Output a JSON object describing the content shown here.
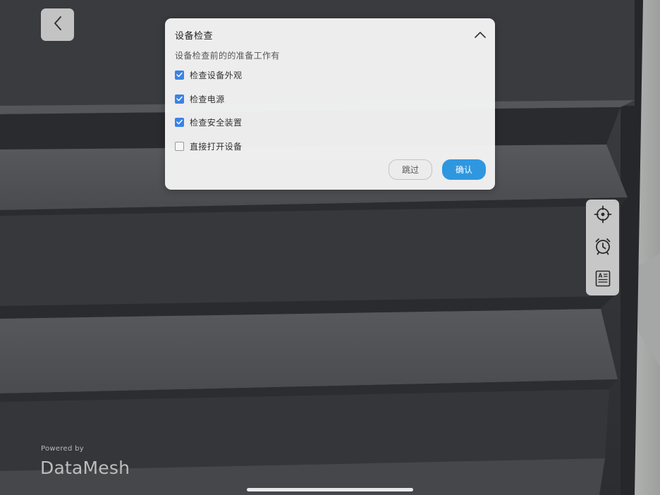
{
  "dialog": {
    "title": "设备检查",
    "description": "设备检查前的的准备工作有",
    "options": [
      {
        "label": "检查设备外观",
        "checked": true
      },
      {
        "label": "检查电源",
        "checked": true
      },
      {
        "label": "检查安全装置",
        "checked": true
      },
      {
        "label": "直接打开设备",
        "checked": false
      }
    ],
    "skip_label": "跳过",
    "confirm_label": "确认"
  },
  "toolbar": {
    "tools": [
      {
        "icon": "crosshair-icon"
      },
      {
        "icon": "alarm-clock-icon"
      },
      {
        "icon": "document-text-icon"
      }
    ]
  },
  "branding": {
    "powered_by": "Powered by",
    "brand_name": "DataMesh"
  },
  "colors": {
    "accent": "#2e97e0",
    "checkbox_checked": "#3b82e6",
    "dialog_bg": "#f3f3f3",
    "scene_dark": "#2f3033"
  }
}
